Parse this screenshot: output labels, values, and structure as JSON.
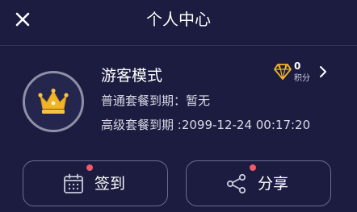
{
  "header": {
    "title": "个人中心",
    "close_icon": "close-icon"
  },
  "profile": {
    "avatar_icon": "crown-icon",
    "username": "游客模式",
    "plan_normal": "普通套餐到期：暂无",
    "plan_advanced": "高级套餐到期 :2099-12-24 00:17:20"
  },
  "points": {
    "icon": "diamond-icon",
    "value": "0",
    "label": "积分"
  },
  "actions": {
    "checkin": {
      "label": "签到",
      "icon": "calendar-icon"
    },
    "share": {
      "label": "分享",
      "icon": "share-icon"
    }
  },
  "colors": {
    "background": "#1b1c40",
    "accent_gold": "#f0b429",
    "notification_dot": "#ef5a68",
    "button_border": "#6c6d92"
  }
}
